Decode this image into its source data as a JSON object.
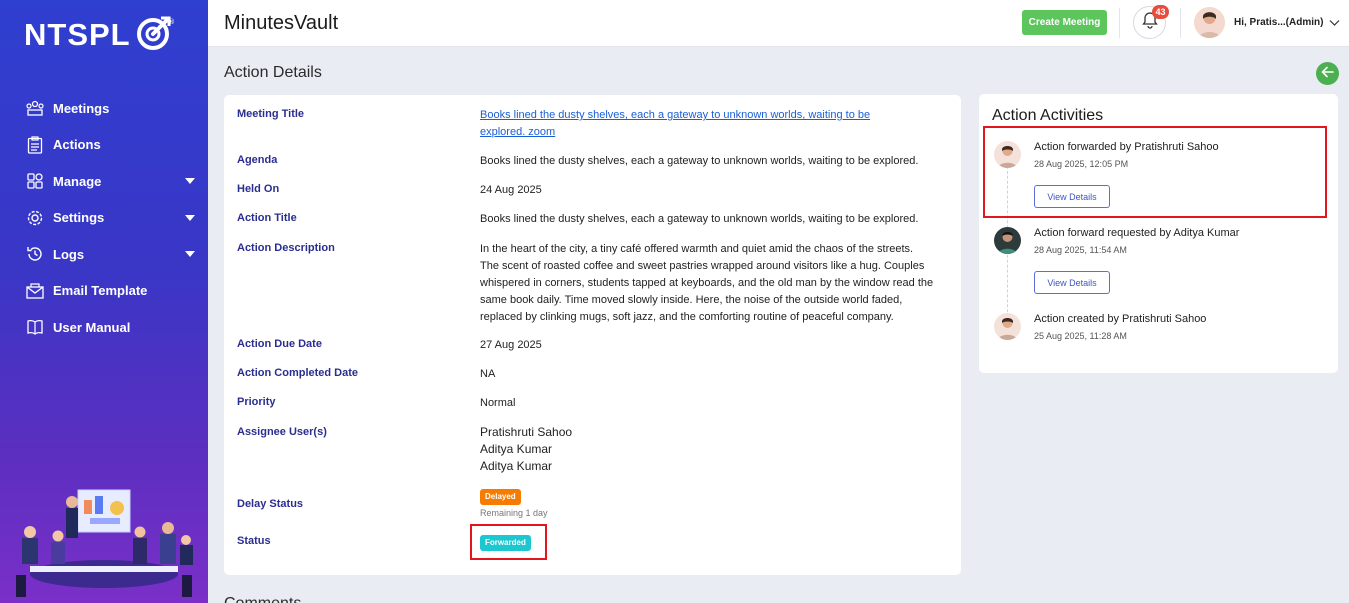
{
  "brand": {
    "logo_text": "NTSPL",
    "registered": "®"
  },
  "sidebar": {
    "items": [
      {
        "label": "Meetings",
        "icon": "meetings-icon",
        "has_caret": false
      },
      {
        "label": "Actions",
        "icon": "clipboard-icon",
        "has_caret": false
      },
      {
        "label": "Manage",
        "icon": "grid-icon",
        "has_caret": true
      },
      {
        "label": "Settings",
        "icon": "gear-icon",
        "has_caret": true
      },
      {
        "label": "Logs",
        "icon": "history-icon",
        "has_caret": true
      },
      {
        "label": "Email Template",
        "icon": "envelope-icon",
        "has_caret": false
      },
      {
        "label": "User Manual",
        "icon": "book-icon",
        "has_caret": false
      }
    ]
  },
  "header": {
    "app_title": "MinutesVault",
    "create_meeting_label": "Create Meeting",
    "notification_count": "43",
    "user_greeting": "Hi, Pratis...(Admin)"
  },
  "page": {
    "title": "Action Details",
    "next_section_title": "Comments"
  },
  "details": {
    "meeting_title": {
      "label": "Meeting Title",
      "line1": "Books lined the dusty shelves, each a gateway to unknown worlds, waiting to be",
      "line2": "explored. zoom"
    },
    "agenda": {
      "label": "Agenda",
      "value": "Books lined the dusty shelves, each a gateway to unknown worlds, waiting to be explored."
    },
    "held_on": {
      "label": "Held On",
      "value": "24 Aug 2025"
    },
    "action_title": {
      "label": "Action Title",
      "value": "Books lined the dusty shelves, each a gateway to unknown worlds, waiting to be explored."
    },
    "action_description": {
      "label": "Action Description",
      "lines": [
        "In the heart of the city, a tiny café offered warmth and quiet amid the chaos of the streets.",
        "The scent of roasted coffee and sweet pastries wrapped around visitors like a hug. Couples",
        "whispered in corners, students tapped at keyboards, and the old man by the window read the",
        "same book daily. Time moved slowly inside. Here, the noise of the outside world faded,",
        "replaced by clinking mugs, soft jazz, and the comforting routine of peaceful company."
      ]
    },
    "due_date": {
      "label": "Action Due Date",
      "value": "27 Aug 2025"
    },
    "completed_date": {
      "label": "Action Completed Date",
      "value": "NA"
    },
    "priority": {
      "label": "Priority",
      "value": "Normal"
    },
    "assignees": {
      "label": "Assignee User(s)",
      "users": [
        "Pratishruti Sahoo",
        "Aditya Kumar",
        "Aditya Kumar"
      ]
    },
    "delay_status": {
      "label": "Delay Status",
      "badge": "Delayed",
      "note": "Remaining 1 day",
      "badge_color": "#f57c00"
    },
    "status": {
      "label": "Status",
      "badge": "Forwarded",
      "badge_color": "#1cc7d0"
    }
  },
  "activities": {
    "title": "Action Activities",
    "view_details_label": "View Details",
    "items": [
      {
        "text": "Action forwarded by Pratishruti Sahoo",
        "time": "28 Aug 2025, 12:05 PM",
        "has_button": true
      },
      {
        "text": "Action forward requested by Aditya Kumar",
        "time": "28 Aug 2025, 11:54 AM",
        "has_button": true
      },
      {
        "text": "Action created by Pratishruti Sahoo",
        "time": "25 Aug 2025, 11:28 AM",
        "has_button": false
      }
    ]
  },
  "colors": {
    "highlight": "#e2161c",
    "label": "#2a2e8f",
    "link": "#1a5fd6",
    "create_button": "#5cc55c"
  }
}
